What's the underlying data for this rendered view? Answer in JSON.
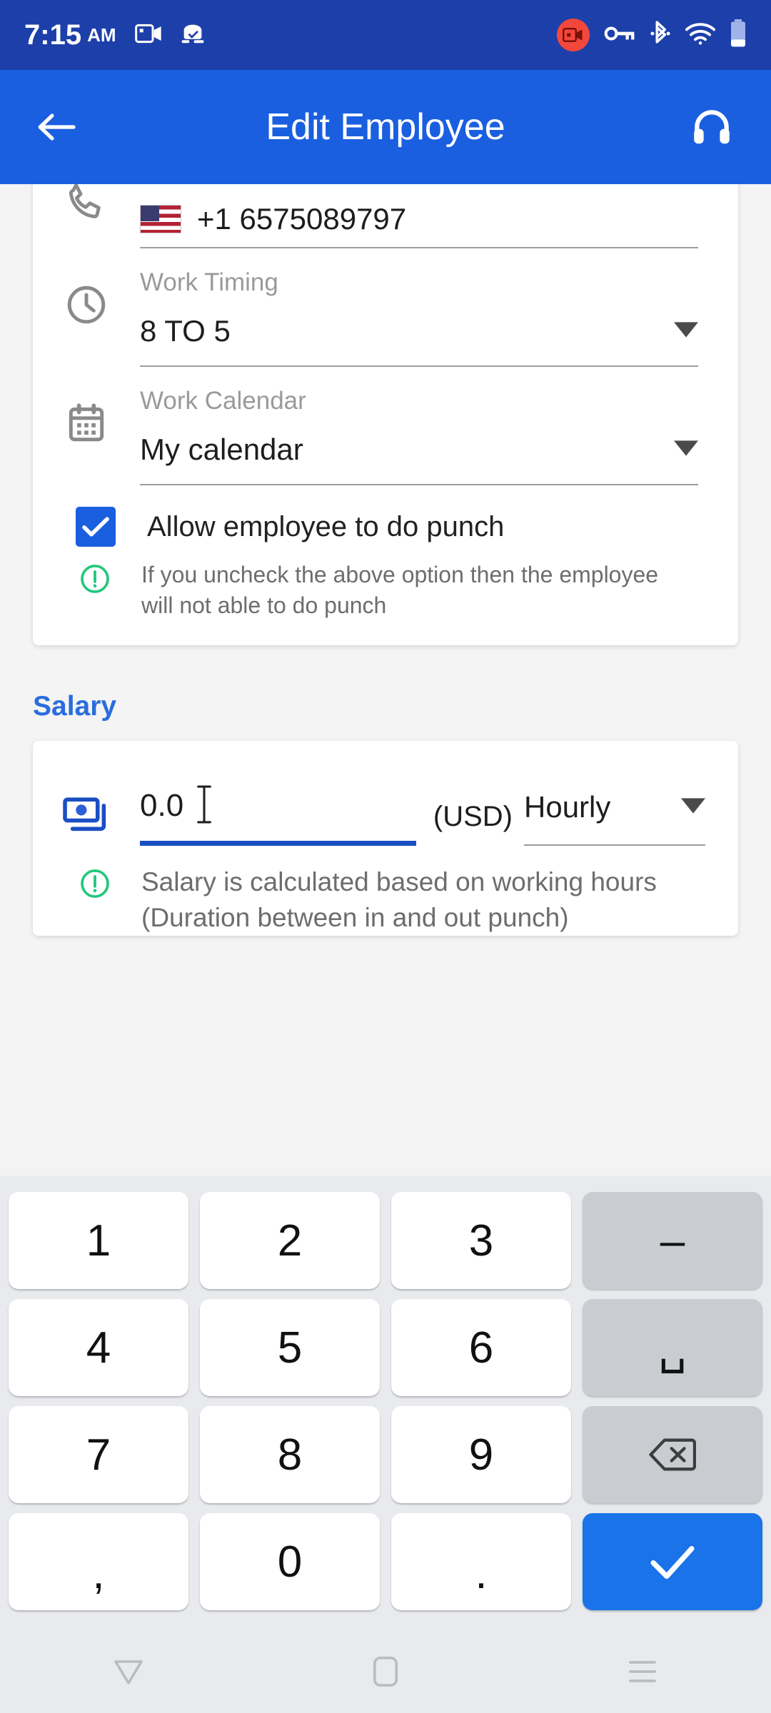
{
  "status_bar": {
    "time": "7:15",
    "ampm": "AM",
    "icons": [
      "screen-record-icon",
      "android-auto-icon",
      "recording-badge-icon",
      "vpn-key-icon",
      "bluetooth-icon",
      "wifi-icon",
      "battery-icon"
    ]
  },
  "app_bar": {
    "title": "Edit Employee",
    "back_icon": "back-arrow-icon",
    "support_icon": "headset-icon"
  },
  "form": {
    "phone": {
      "icon": "phone-icon",
      "flag": "us-flag-icon",
      "value": "+1 6575089797"
    },
    "work_timing": {
      "icon": "clock-icon",
      "label": "Work Timing",
      "value": "8 TO 5",
      "arrow": "dropdown-arrow-icon"
    },
    "work_calendar": {
      "icon": "calendar-icon",
      "label": "Work Calendar",
      "value": "My calendar",
      "arrow": "dropdown-arrow-icon"
    },
    "punch_permission": {
      "checked": true,
      "label": "Allow employee to do punch",
      "note_icon": "info-circle-icon",
      "note": "If you uncheck the above option then the employee will not able to do punch"
    }
  },
  "salary_section": {
    "heading": "Salary",
    "icon": "money-icon",
    "amount": "0.0",
    "cursor": "text-caret-icon",
    "currency": "(USD)",
    "period": "Hourly",
    "period_arrow": "dropdown-arrow-icon",
    "note_icon": "info-circle-icon",
    "note_line1": "Salary is calculated based on working hours",
    "note_line2": "(Duration between in and out punch)"
  },
  "keyboard": {
    "rows": [
      [
        {
          "label": "1",
          "type": "num",
          "name": "key-1"
        },
        {
          "label": "2",
          "type": "num",
          "name": "key-2"
        },
        {
          "label": "3",
          "type": "num",
          "name": "key-3"
        },
        {
          "label": "–",
          "type": "fn",
          "name": "key-dash"
        }
      ],
      [
        {
          "label": "4",
          "type": "num",
          "name": "key-4"
        },
        {
          "label": "5",
          "type": "num",
          "name": "key-5"
        },
        {
          "label": "6",
          "type": "num",
          "name": "key-6"
        },
        {
          "label": "␣",
          "type": "fn",
          "name": "key-space"
        }
      ],
      [
        {
          "label": "7",
          "type": "num",
          "name": "key-7"
        },
        {
          "label": "8",
          "type": "num",
          "name": "key-8"
        },
        {
          "label": "9",
          "type": "num",
          "name": "key-9"
        },
        {
          "label": "",
          "type": "backspace",
          "name": "key-backspace"
        }
      ],
      [
        {
          "label": ",",
          "type": "num",
          "name": "key-comma"
        },
        {
          "label": "0",
          "type": "num",
          "name": "key-0"
        },
        {
          "label": ".",
          "type": "num",
          "name": "key-period"
        },
        {
          "label": "",
          "type": "enter",
          "name": "key-enter"
        }
      ]
    ]
  },
  "nav_bar": {
    "back": "nav-back-icon",
    "home": "nav-home-icon",
    "recents": "nav-recents-icon"
  },
  "colors": {
    "status_bar": "#1c3faa",
    "app_bar": "#1a5fe0",
    "accent": "#2b6cde",
    "checkbox": "#1a5fe0",
    "enter_key": "#1a73e8",
    "info_green": "#21c77c",
    "active_underline": "#1a4fc4"
  }
}
